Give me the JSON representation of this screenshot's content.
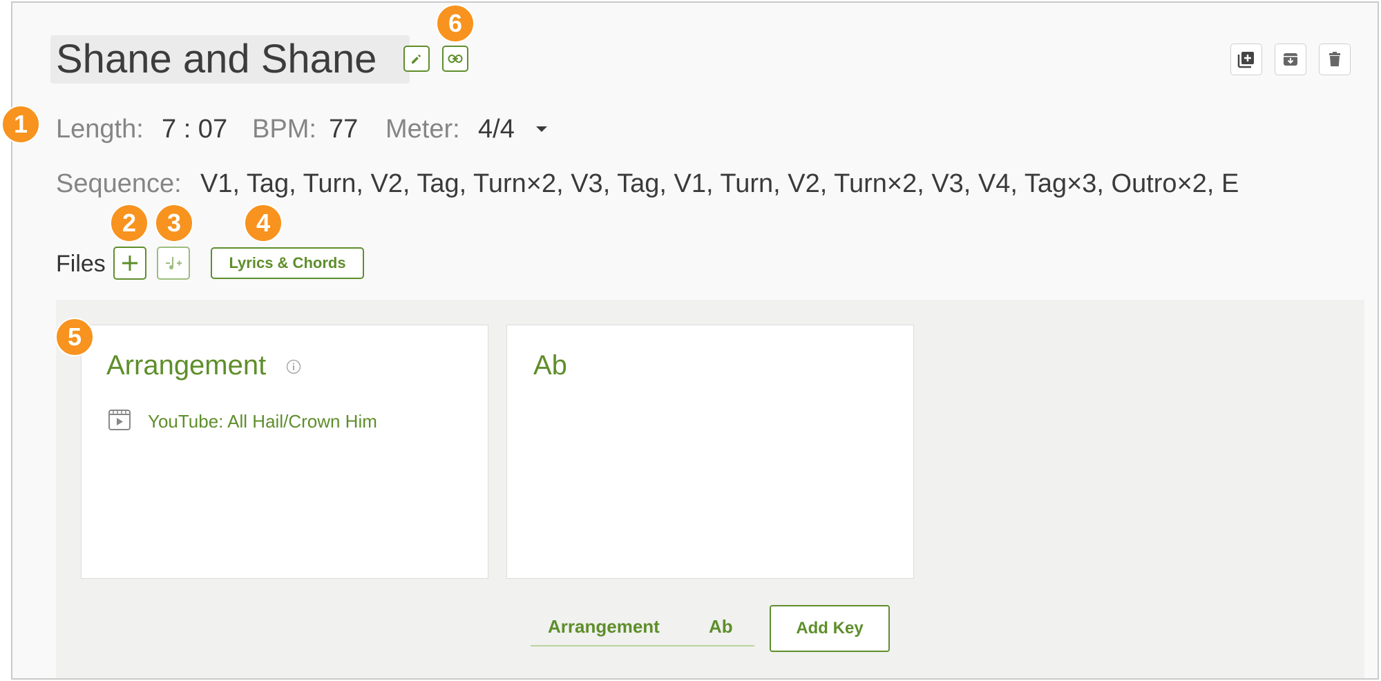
{
  "song": {
    "title": "Shane and Shane",
    "length_label": "Length:",
    "length_value": "7 : 07",
    "bpm_label": "BPM:",
    "bpm_value": "77",
    "meter_label": "Meter:",
    "meter_value": "4/4",
    "sequence_label": "Sequence:",
    "sequence_value": "V1, Tag, Turn, V2, Tag, Turn×2, V3, Tag, V1, Turn, V2, Turn×2, V3, V4, Tag×3, Outro×2, E"
  },
  "files": {
    "label": "Files",
    "add_icon": "plus-icon",
    "music_icon": "music-note-plus-icon",
    "lyrics_button": "Lyrics & Chords"
  },
  "cards": [
    {
      "title": "Arrangement",
      "info_icon": "info-icon",
      "link_icon": "video-file-icon",
      "link_text": "YouTube: All Hail/Crown Him"
    },
    {
      "title": "Ab"
    }
  ],
  "tabs": [
    "Arrangement",
    "Ab"
  ],
  "add_key_label": "Add Key",
  "toolbar_icons": [
    "duplicate-icon",
    "archive-icon",
    "trash-icon"
  ],
  "header_icons": [
    "pencil-icon",
    "link-icon"
  ],
  "badges": [
    "1",
    "2",
    "3",
    "4",
    "5",
    "6"
  ],
  "colors": {
    "accent": "#5e8e2a",
    "badge": "#f7931e",
    "panel": "#f1f1f0"
  }
}
